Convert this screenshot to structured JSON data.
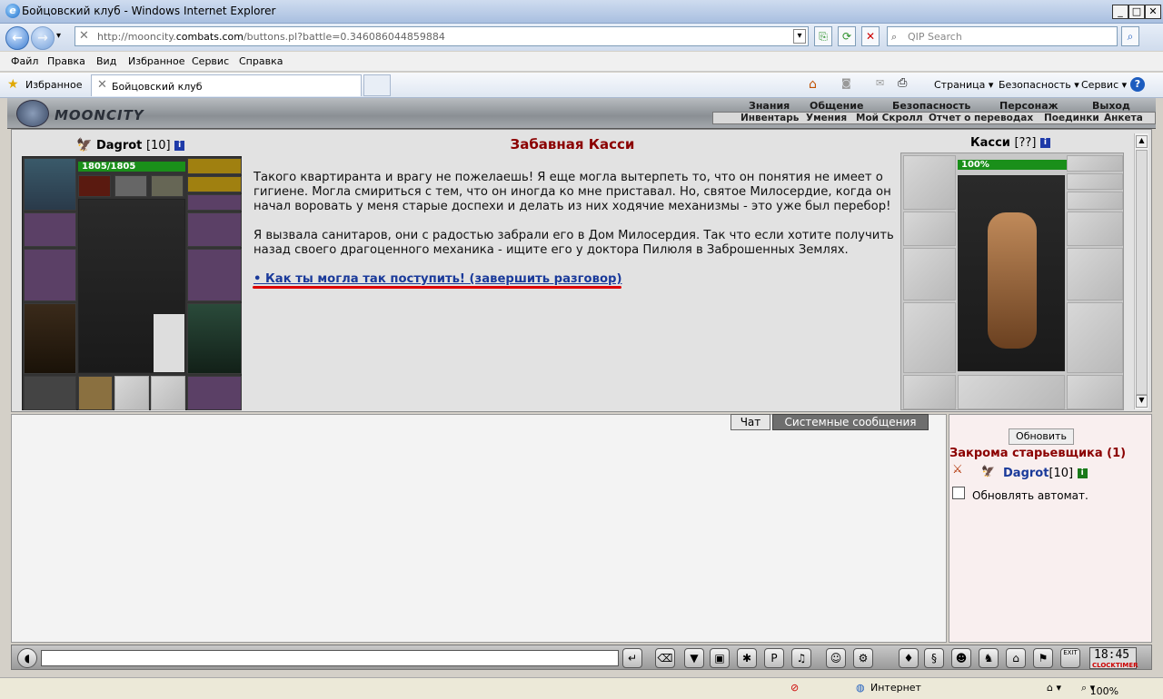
{
  "window": {
    "title": "Бойцовский клуб - Windows Internet Explorer"
  },
  "address": {
    "url_pre": "http://mooncity.",
    "url_domain": "combats.com",
    "url_post": "/buttons.pl?battle=0.346086044859884",
    "search_placeholder": "QIP Search"
  },
  "menu": {
    "items": [
      "Файл",
      "Правка",
      "Вид",
      "Избранное",
      "Сервис",
      "Справка"
    ]
  },
  "favbar": {
    "favorites": "Избранное",
    "tab_title": "Бойцовский клуб",
    "page": "Страница",
    "security": "Безопасность",
    "service": "Сервис"
  },
  "game": {
    "logo": "MOONCITY",
    "topnav": [
      "Знания",
      "Общение",
      "Безопасность",
      "Персонаж",
      "Выход"
    ],
    "subnav": [
      "Инвентарь",
      "Умения",
      "Мой Скролл",
      "Отчет о переводах",
      "Поединки",
      "Анкета"
    ]
  },
  "player": {
    "name": "Dagrot",
    "level": "[10]",
    "hp": "1805/1805"
  },
  "dialog": {
    "title": "Забавная Касси",
    "p1": "Такого квартиранта и врагу не пожелаешь! Я еще могла вытерпеть то, что он понятия не имеет о гигиене. Могла смириться с тем, что он иногда ко мне приставал. Но, святое Милосердие, когда он начал воровать у меня старые доспехи и делать из них ходячие механизмы - это уже был перебор!",
    "p2": "Я вызвала санитаров, они с радостью забрали его в Дом Милосердия. Так что если хотите получить назад своего драгоценного механика - ищите его у доктора Пилюля в Заброшенных Землях.",
    "link": "• Как ты могла так поступить! (завершить разговор)"
  },
  "npc": {
    "name": "Касси",
    "level": "[??]",
    "hp": "100%"
  },
  "chat": {
    "tab_chat": "Чат",
    "tab_system": "Системные сообщения"
  },
  "side": {
    "refresh": "Обновить",
    "location": "Закрома старьевщика (1)",
    "player": "Dagrot",
    "player_level": "[10]",
    "auto": "Обновлять автомат."
  },
  "bottom": {
    "exit": "EXIT",
    "time": "18:45",
    "clock": "CLOCK",
    "timer": "TIMER"
  },
  "status": {
    "zone": "Интернет",
    "zoom": "100%"
  }
}
